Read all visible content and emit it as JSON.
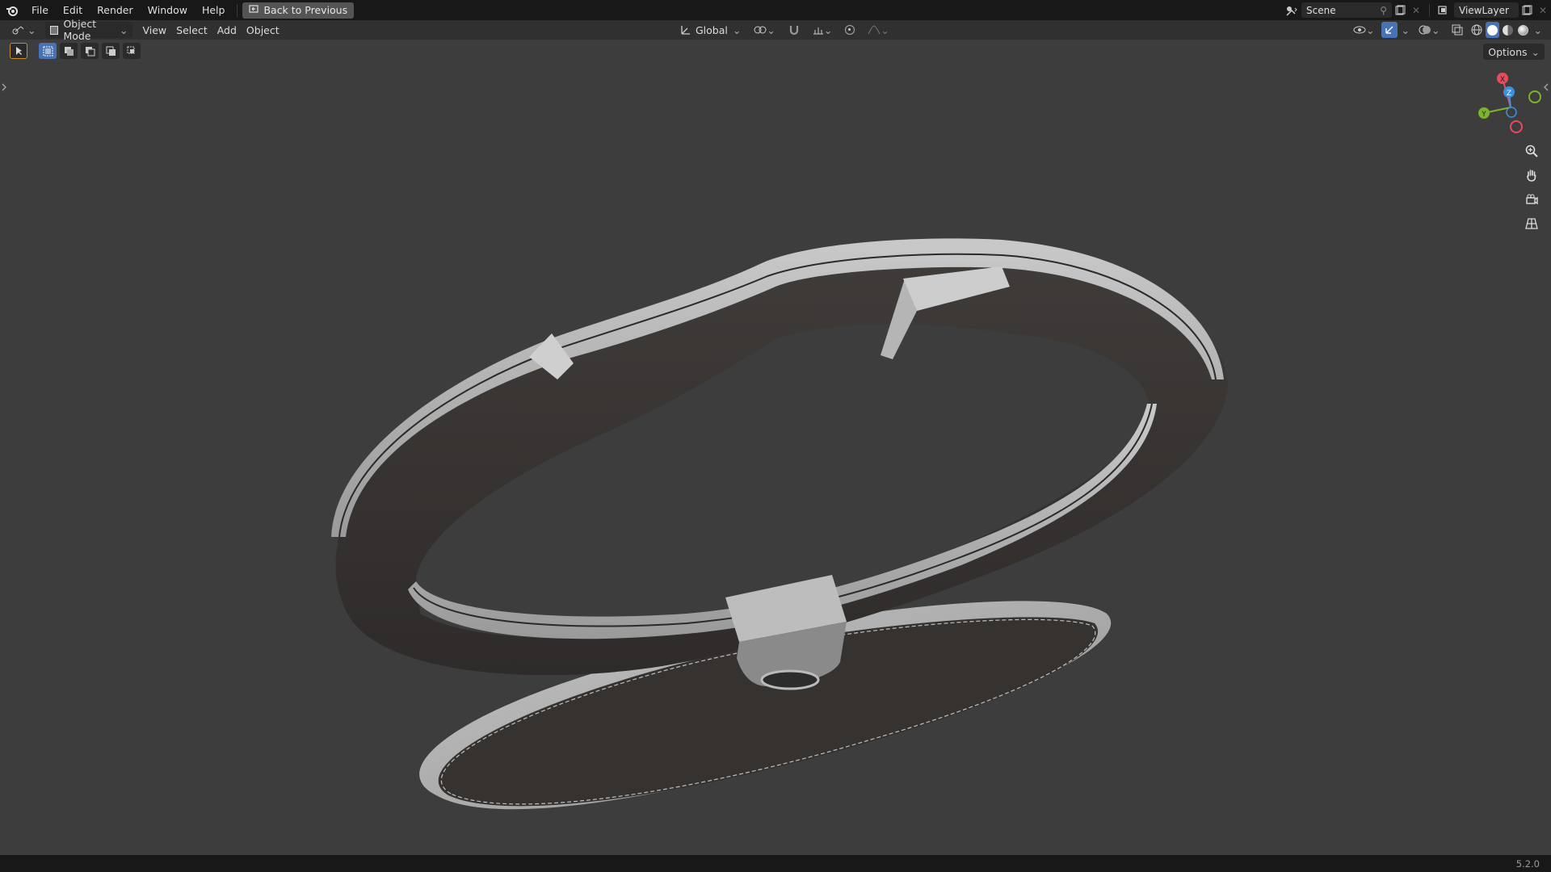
{
  "topbar": {
    "menu": [
      "File",
      "Edit",
      "Render",
      "Window",
      "Help"
    ],
    "back_button": "Back to Previous",
    "scene_name": "Scene",
    "view_layer": "ViewLayer"
  },
  "header": {
    "mode": "Object Mode",
    "menus": [
      "View",
      "Select",
      "Add",
      "Object"
    ],
    "transform_orientation": "Global",
    "options_label": "Options"
  },
  "gizmo": {
    "axes": [
      "X",
      "Y",
      "Z"
    ],
    "colors": {
      "x": "#e84a5f",
      "y": "#7bb52a",
      "z": "#3f8fe0"
    }
  },
  "statusbar": {
    "version": "5.2.0"
  },
  "colors": {
    "background": "#3d3d3d",
    "topbar": "#181818",
    "header": "#303030",
    "accent": "#4772b3"
  }
}
